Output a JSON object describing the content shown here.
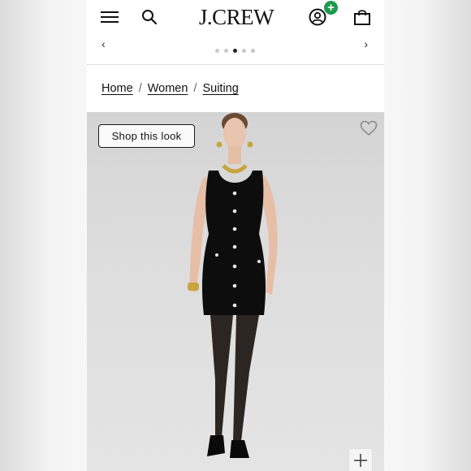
{
  "header": {
    "logo_text": "J.CREW",
    "icons": [
      "menu-icon",
      "search-icon",
      "account-icon",
      "shopping-bag-icon"
    ],
    "badge_symbol": "+",
    "badge_color": "#1d9a4d"
  },
  "promo_carousel": {
    "prev_symbol": "‹",
    "next_symbol": "›",
    "slide_count": 5,
    "active_slide": 3
  },
  "breadcrumb": {
    "items": [
      "Home",
      "Women",
      "Suiting"
    ],
    "separator": "/"
  },
  "product_image": {
    "shop_look_label": "Shop this look",
    "icons": [
      "heart-icon",
      "zoom-plus-icon"
    ]
  }
}
